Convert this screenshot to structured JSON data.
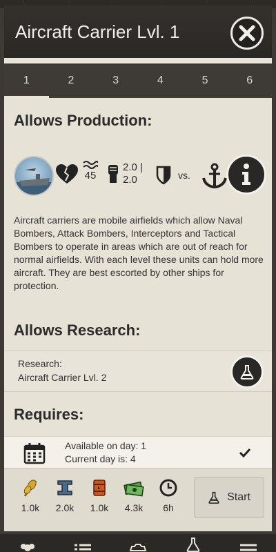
{
  "window": {
    "title": "Aircraft Carrier Lvl. 1"
  },
  "tabs": [
    "1",
    "2",
    "3",
    "4",
    "5",
    "6"
  ],
  "active_tab": "1",
  "sections": {
    "allows_production": "Allows Production:",
    "allows_research": "Allows Research:",
    "requires": "Requires:"
  },
  "unit_stats": {
    "speed": "45",
    "attack_line1": "2.0 |",
    "attack_line2": "2.0",
    "vs_label": "vs."
  },
  "description": "Aircraft carriers are mobile airfields which allow Naval Bombers, Attack Bombers, Interceptors and Tactical Bombers to operate in areas which are out of reach for normal airfields. With each level these units can hold more aircraft. They are best escorted by other ships for protection.",
  "research": {
    "label": "Research:",
    "item": "Aircraft Carrier Lvl. 2"
  },
  "requirement": {
    "available_line": "Available on day: 1",
    "current_line": "Current day is: 4"
  },
  "costs": [
    {
      "icon": "grain-icon",
      "value": "1.0k"
    },
    {
      "icon": "steel-icon",
      "value": "2.0k"
    },
    {
      "icon": "oil-barrel-icon",
      "value": "1.0k"
    },
    {
      "icon": "money-icon",
      "value": "4.3k"
    },
    {
      "icon": "clock-icon",
      "value": "6h"
    }
  ],
  "start_button": {
    "label": "Start"
  },
  "colors": {
    "header": "#2f2c29",
    "tab_bar": "#3e3b37",
    "panel": "#e6e2d6",
    "accent_dark": "#2a2826"
  }
}
